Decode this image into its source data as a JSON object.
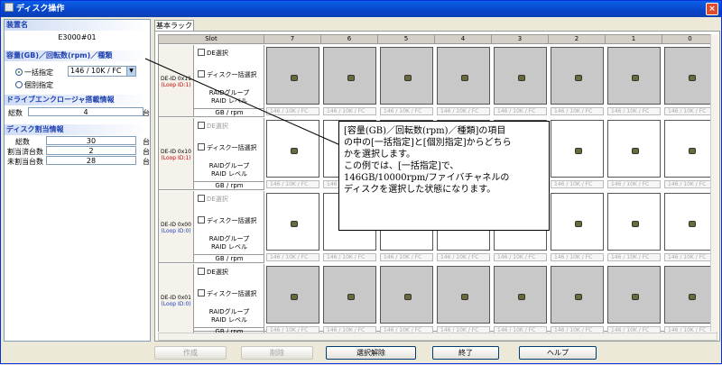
{
  "window": {
    "title": "ディスク操作",
    "close": "×"
  },
  "left": {
    "device_header": "装置名",
    "device_name": "E3000#01",
    "capacity_header": "容量(GB)／回転数(rpm)／種類",
    "radio_bulk": "一括指定",
    "combo_value": "146 / 10K / FC",
    "radio_individual": "個別指定",
    "enclosure_header": "ドライブエンクロージャ搭載情報",
    "total_label": "総数",
    "total_value": "4",
    "total_unit": "台",
    "alloc_header": "ディスク割当情報",
    "alloc_total_label": "総数",
    "alloc_total_value": "30",
    "alloc_total_unit": "台",
    "allocated_label": "割当済台数",
    "allocated_value": "2",
    "allocated_unit": "台",
    "unallocated_label": "未割当台数",
    "unallocated_value": "28",
    "unallocated_unit": "台"
  },
  "tab": "基本ラック",
  "grid": {
    "slot_header": "Slot",
    "slots": [
      "7",
      "6",
      "5",
      "4",
      "3",
      "2",
      "1",
      "0"
    ],
    "rows": [
      {
        "de": "DE-ID 0x11",
        "loop": "(Loop ID:1)",
        "de_select": "DE選択",
        "disk_select": "ディスク一括選択",
        "raid_group": "RAIDグループ",
        "raid_level": "RAID レベル",
        "gb": "GB / rpm"
      },
      {
        "de": "DE-ID 0x10",
        "loop": "(Loop ID:1)",
        "de_select": "DE選択",
        "disk_select": "ディスク一括選択",
        "raid_group": "RAIDグループ",
        "raid_level": "RAID レベル",
        "gb": "GB / rpm"
      },
      {
        "de": "DE-ID 0x00",
        "loop": "(Loop ID:0)",
        "de_select": "DE選択",
        "disk_select": "ディスク一括選択",
        "raid_group": "RAIDグループ",
        "raid_level": "RAID レベル",
        "gb": "GB / rpm"
      },
      {
        "de": "DE-ID 0x01",
        "loop": "(Loop ID:0)",
        "de_select": "DE選択",
        "disk_select": "ディスク一括選択",
        "raid_group": "RAIDグループ",
        "raid_level": "RAID レベル",
        "gb": "GB / rpm"
      }
    ],
    "cap_label": "146 / 10K / FC"
  },
  "buttons": {
    "create": "作成",
    "delete": "削除",
    "deselect": "選択解除",
    "finish": "終了",
    "help": "ヘルプ"
  },
  "callout": {
    "line1": "[容量(GB)／回転数(rpm)／種類]の項目",
    "line2": "の中の[一括指定]と[個別指定]からどちら",
    "line3": "かを選択します。",
    "line4": "この例では、[一括指定]で、",
    "line5": "146GB/10000rpm/ファイバチャネルの",
    "line6": "ディスクを選択した状態になります。"
  },
  "colors": {
    "title": "#0845c8",
    "section": "#1c3fb0",
    "loop1": "#cc0000",
    "loop0": "#2040c0"
  }
}
